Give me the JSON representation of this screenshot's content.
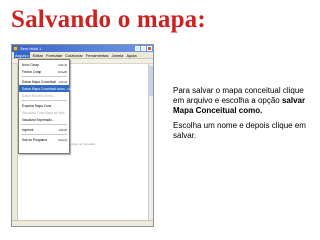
{
  "slide": {
    "title": "Salvando o mapa:"
  },
  "app": {
    "window_title": "Sem título 1",
    "menus": [
      "Arquivo",
      "Editar",
      "Formatar",
      "Colaborar",
      "Ferramentas",
      "Janela",
      "Ajuda"
    ],
    "active_menu": "Arquivo",
    "file_menu": [
      {
        "label": "Novo Cmap",
        "shortcut": "Ctrl+N",
        "state": "normal"
      },
      {
        "label": "Fechar Cmap",
        "shortcut": "Ctrl+W",
        "state": "normal"
      },
      {
        "separator": true
      },
      {
        "label": "Salvar Mapa Conceitual",
        "shortcut": "Ctrl+S",
        "state": "normal"
      },
      {
        "label": "Salvar Mapa Conceitual como...",
        "shortcut": "Ctrl+Shift+S",
        "state": "selected"
      },
      {
        "label": "Salvar Recurso como...",
        "shortcut": "",
        "state": "disabled"
      },
      {
        "separator": true
      },
      {
        "label": "Exportar Mapa Cons",
        "shortcut": "",
        "state": "normal"
      },
      {
        "label": "Visualizar Cons Mapa as Web",
        "shortcut": "",
        "state": "disabled"
      },
      {
        "label": "Visualizar Expressão...",
        "shortcut": "",
        "state": "normal"
      },
      {
        "separator": true
      },
      {
        "label": "Imprimir",
        "shortcut": "Ctrl+P",
        "state": "normal"
      },
      {
        "separator": true
      },
      {
        "label": "Sair do Programa",
        "shortcut": "Ctrl+Q",
        "state": "normal"
      }
    ],
    "canvas_hint": "Clique duas vezes para criar um conceito"
  },
  "instructions": {
    "para1_text": "Para salvar o mapa conceitual clique em arquivo e escolha a opção",
    "para1_bold": "salvar Mapa Conceitual como.",
    "para2": "Escolha um nome e depois clique em salvar."
  },
  "colors": {
    "title": "#cc2222",
    "menu_highlight": "#316ac5",
    "titlebar": "#3a64c8"
  }
}
